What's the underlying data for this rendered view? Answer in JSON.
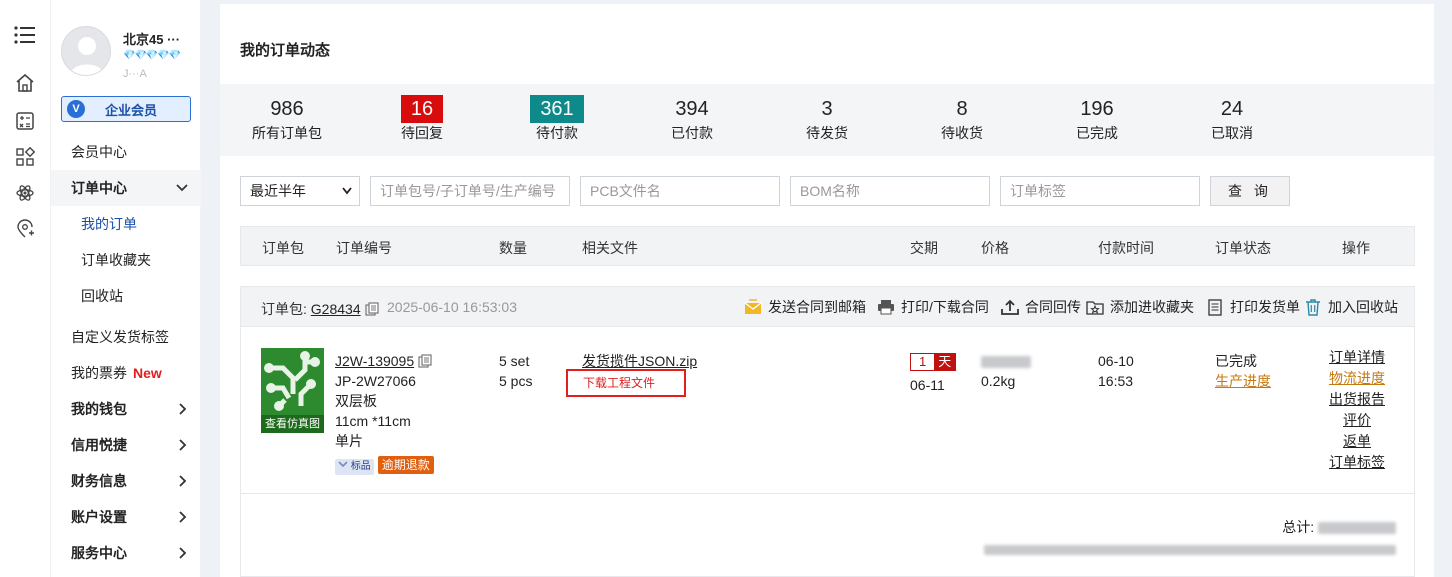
{
  "rail": {
    "icons": [
      "menu-icon",
      "home-icon",
      "calculator-icon",
      "apps-icon",
      "atom-icon",
      "location-add-icon"
    ]
  },
  "user": {
    "name": "北京45 ···",
    "diamonds": "💎💎💎💎💎",
    "sub": "J···A",
    "vip_label": "企业会员",
    "vip_badge": "V"
  },
  "menu": {
    "member_center": "会员中心",
    "order_center": "订单中心",
    "my_orders": "我的订单",
    "order_favorites": "订单收藏夹",
    "recycle": "回收站",
    "custom_label": "自定义发货标签",
    "my_tickets": "我的票券",
    "new_tag": "New",
    "wallet": "我的钱包",
    "credit": "信用悦捷",
    "finance": "财务信息",
    "account": "账户设置",
    "service": "服务中心"
  },
  "page": {
    "title": "我的订单动态"
  },
  "stats": [
    {
      "num": "986",
      "label": "所有订单包"
    },
    {
      "num": "16",
      "label": "待回复"
    },
    {
      "num": "361",
      "label": "待付款"
    },
    {
      "num": "394",
      "label": "已付款"
    },
    {
      "num": "3",
      "label": "待发货"
    },
    {
      "num": "8",
      "label": "待收货"
    },
    {
      "num": "196",
      "label": "已完成"
    },
    {
      "num": "24",
      "label": "已取消"
    }
  ],
  "filters": {
    "period": "最近半年",
    "order_no_placeholder": "订单包号/子订单号/生产编号",
    "pcb_placeholder": "PCB文件名",
    "bom_placeholder": "BOM名称",
    "tag_placeholder": "订单标签",
    "query_label": "查 询"
  },
  "table_headers": [
    "订单包",
    "订单编号",
    "数量",
    "相关文件",
    "交期",
    "价格",
    "付款时间",
    "订单状态",
    "操作"
  ],
  "order": {
    "pkg_label": "订单包:",
    "pkg_no": "G28434",
    "date": "2025-06-10 16:53:03",
    "actions": [
      "发送合同到邮箱",
      "打印/下载合同",
      "合同回传",
      "添加进收藏夹",
      "打印发货单",
      "加入回收站"
    ],
    "thumb_label": "查看仿真图",
    "order_no": "J2W-139095",
    "jp_no": "JP-2W27066",
    "board_type": "双层板",
    "size": "11cm *11cm",
    "piece": "单片",
    "tag_std": "标品",
    "tag_refund": "逾期退款",
    "qty_set": "5 set",
    "qty_pcs": "5 pcs",
    "file": "发货揽件JSON.zip",
    "download": "下载工程文件",
    "lead_num": "1",
    "lead_unit": "天",
    "delivery_date": "06-11",
    "weight": "0.2kg",
    "pay_date": "06-10",
    "pay_time": "16:53",
    "status": "已完成",
    "status_link": "生产进度",
    "ops": [
      "订单详情",
      "物流进度",
      "出货报告",
      "评价",
      "返单",
      "订单标签"
    ],
    "total_label": "总计:"
  }
}
